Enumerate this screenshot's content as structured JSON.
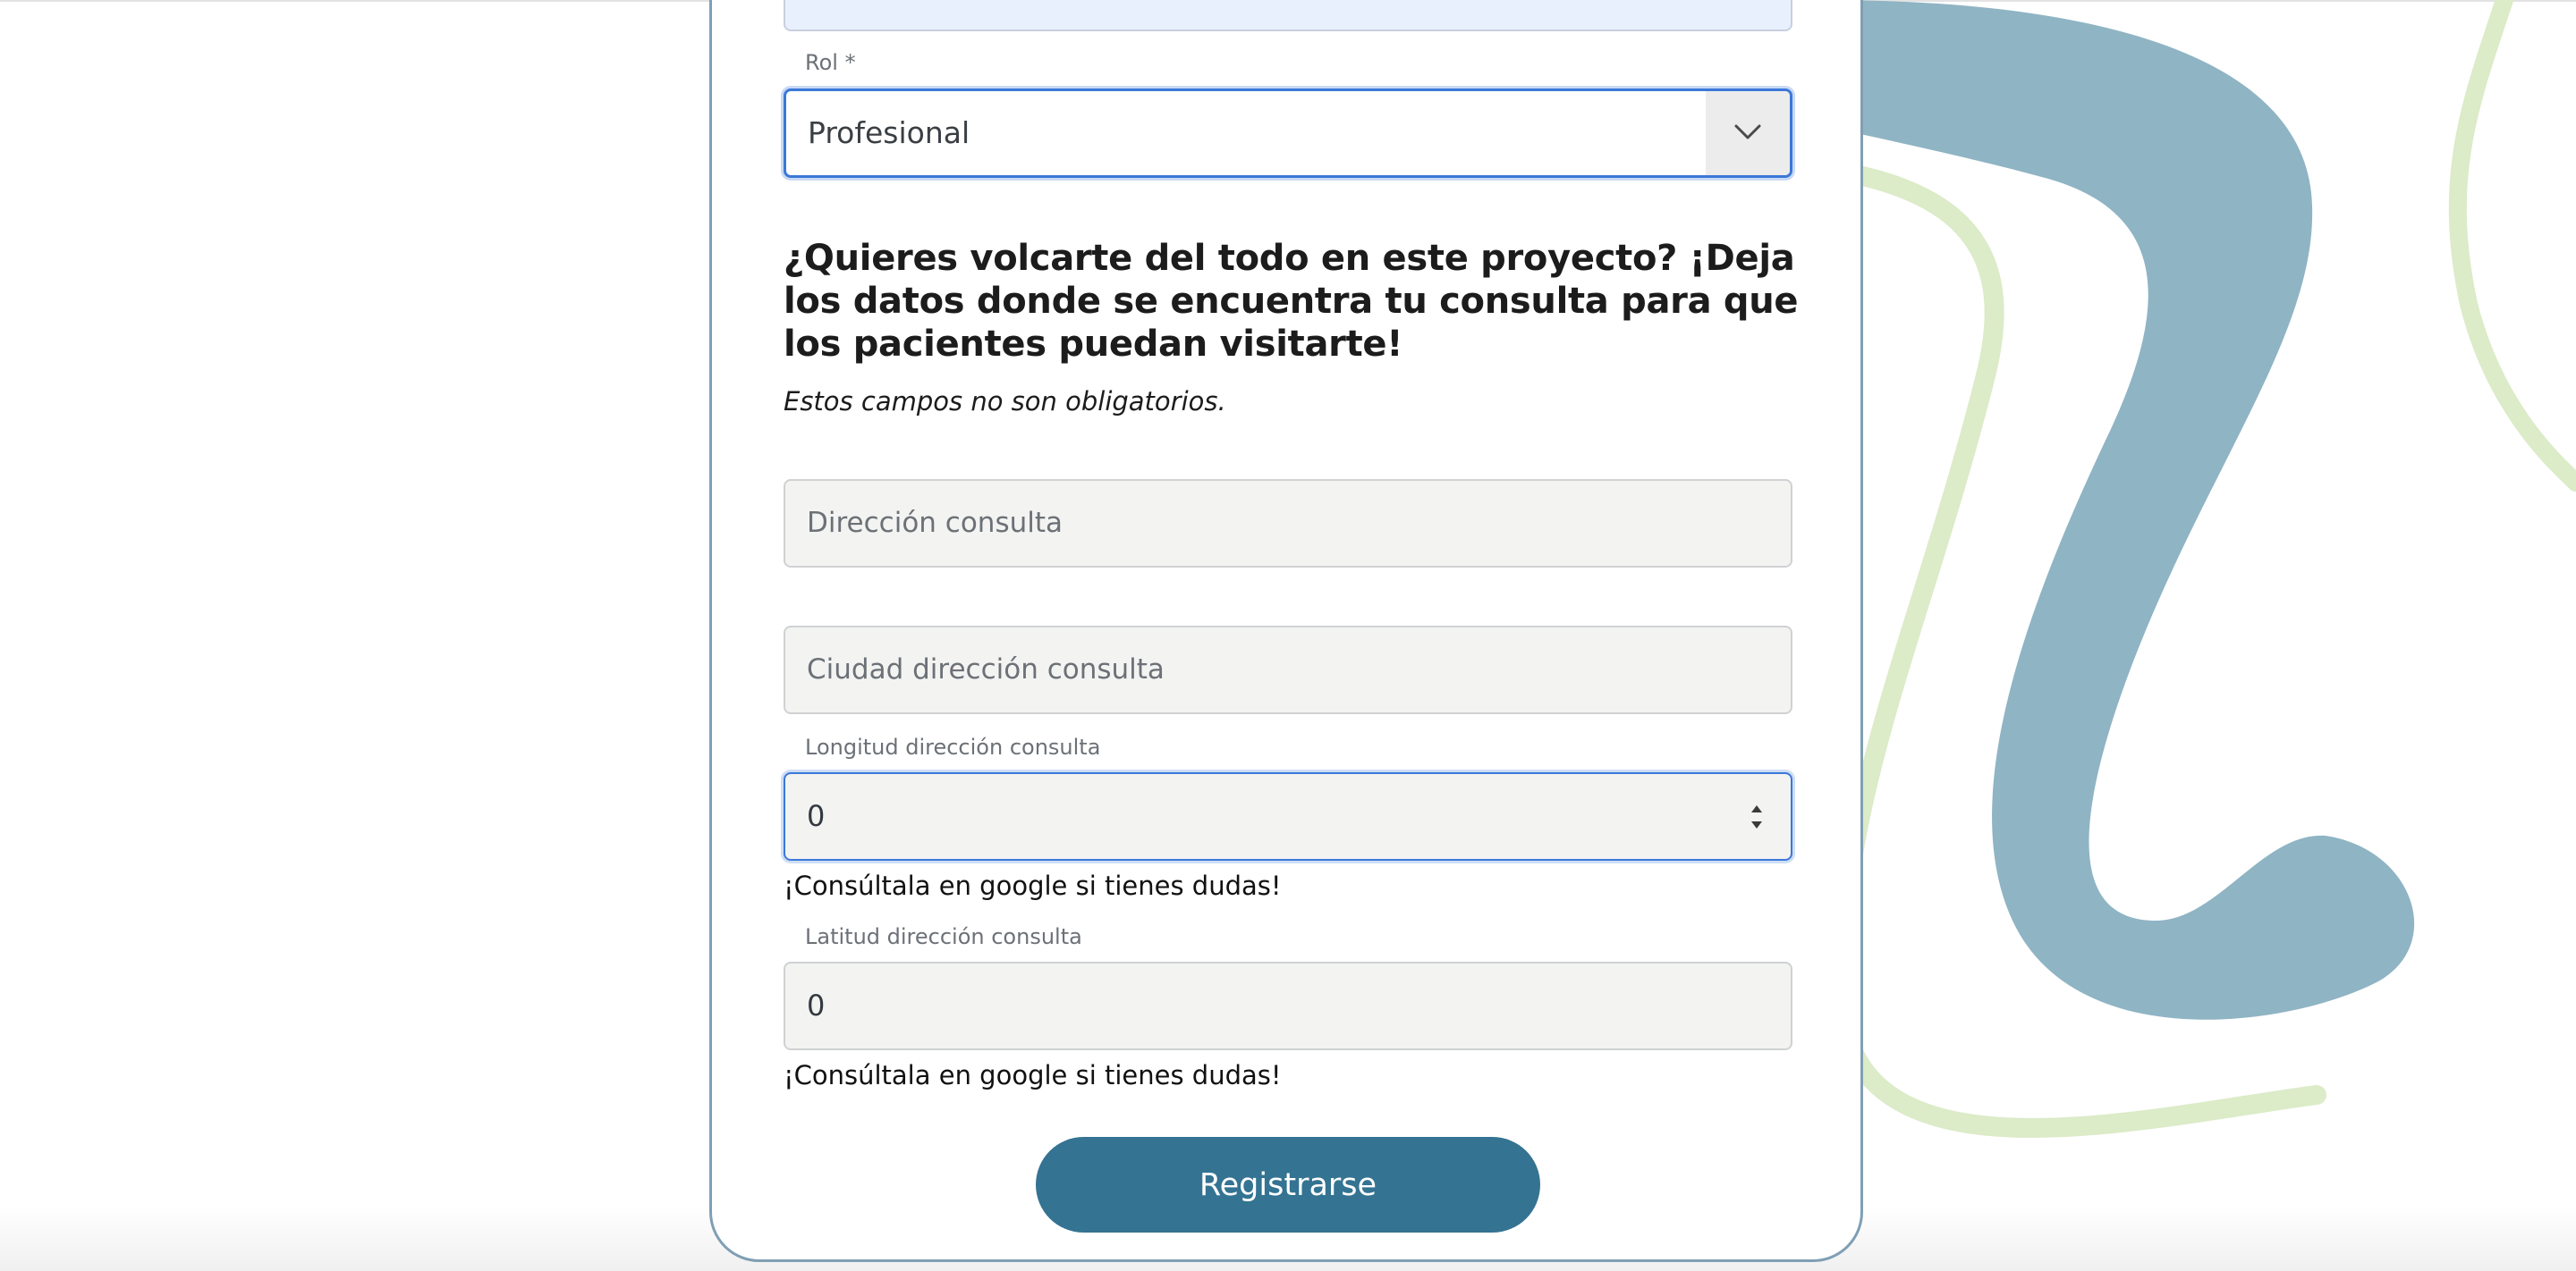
{
  "colors": {
    "accent": "#347392",
    "focus": "#3b78d8",
    "blob": "#8fb4c4",
    "line": "#d9e8c3",
    "card_border": "#7f9fb4"
  },
  "form": {
    "role_label": "Rol *",
    "role_value": "Profesional",
    "heading": "¿Quieres volcarte del todo en este proyecto? ¡Deja los datos donde se encuentra tu consulta para que los pacientes puedan visitarte!",
    "note": "Estos campos no son obligatorios.",
    "address_placeholder": "Dirección consulta",
    "city_placeholder": "Ciudad dirección consulta",
    "longitude_label": "Longitud dirección consulta",
    "longitude_value": "0",
    "longitude_help": "¡Consúltala en google si tienes dudas!",
    "latitude_label": "Latitud dirección consulta",
    "latitude_value": "0",
    "latitude_help": "¡Consúltala en google si tienes dudas!",
    "submit_label": "Registrarse"
  },
  "icons": {
    "select_arrow": "chevron-down-icon",
    "number_spinner": "spinner-arrows-icon"
  }
}
